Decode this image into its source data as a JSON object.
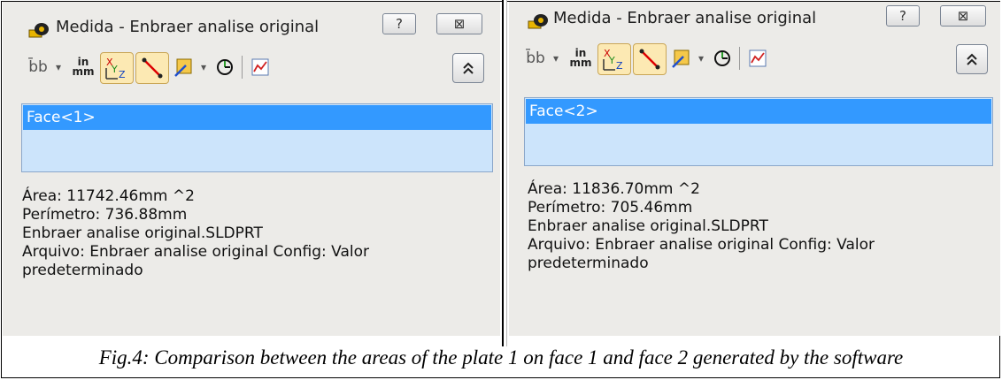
{
  "panels": [
    {
      "window_title": "Medida - Enbraer analise original",
      "help_label": "?",
      "close_label": "⊠",
      "collapse_label": "«",
      "selection": "Face<1>",
      "info": {
        "area": "Área: 11742.46mm ^2",
        "perimeter": "Perímetro: 736.88mm",
        "file": "Enbraer analise original.SLDPRT",
        "archive_line1": "Arquivo: Enbraer analise original Config: Valor",
        "archive_line2": "predeterminado"
      }
    },
    {
      "window_title": "Medida - Enbraer analise original",
      "help_label": "?",
      "close_label": "⊠",
      "collapse_label": "«",
      "selection": "Face<2>",
      "info": {
        "area": "Área: 11836.70mm ^2",
        "perimeter": "Perímetro: 705.46mm",
        "file": "Enbraer analise original.SLDPRT",
        "archive_line1": "Arquivo: Enbraer analise original Config: Valor",
        "archive_line2": "predeterminado"
      }
    }
  ],
  "toolbar": {
    "units_icon_label": "in mm",
    "units_top": "in",
    "units_bottom": "mm",
    "xyz_x": "X",
    "xyz_y": "Y",
    "xyz_z": "Z",
    "dropdown_glyph": "▾"
  },
  "icons": {
    "title": "measure-tool-icon",
    "units": "units-in-mm-icon",
    "xyz": "xyz-coordinates-icon",
    "point_to_point": "point-to-point-icon",
    "projection": "projection-icon",
    "history": "measure-history-icon",
    "sensor": "sensor-icon"
  },
  "colors": {
    "selection_highlight": "#3399ff",
    "selection_box": "#cce4fb",
    "panel_bg": "#ecebe8"
  },
  "caption": "Fig.4: Comparison between the areas of the plate 1 on face 1 and face 2 generated by the software"
}
